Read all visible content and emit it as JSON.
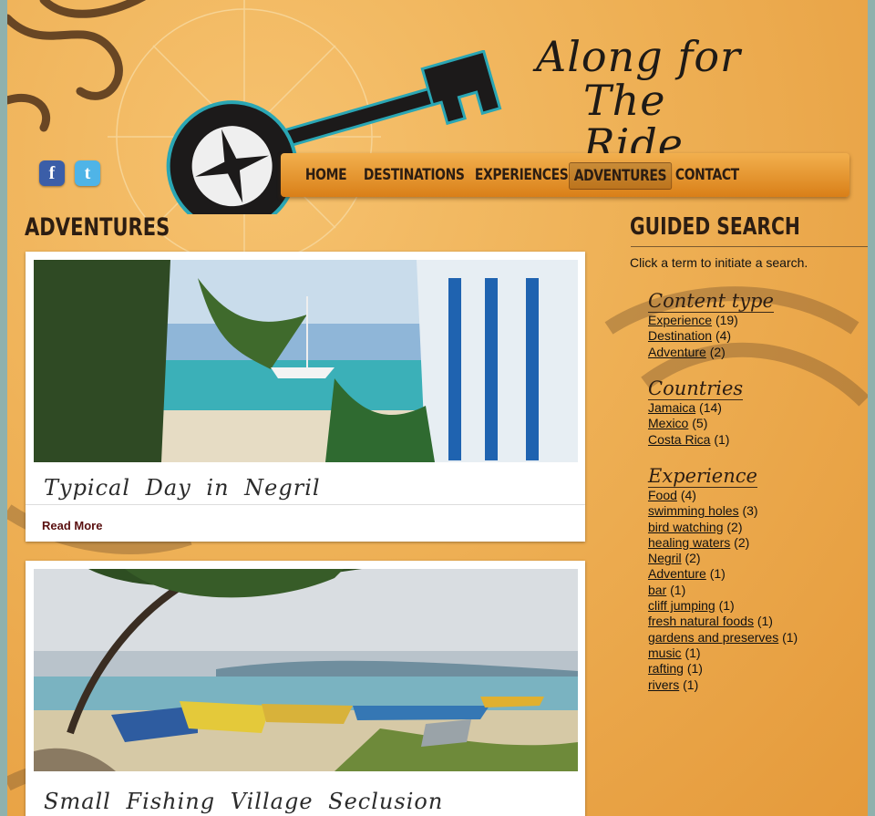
{
  "site": {
    "title_line1": "Along for",
    "title_line2": "The Ride",
    "social": [
      {
        "icon": "facebook-icon",
        "glyph": "f",
        "color": "#3b5ea8"
      },
      {
        "icon": "twitter-icon",
        "glyph": "t",
        "color": "#4fb4e7"
      }
    ]
  },
  "nav": {
    "items": [
      "HOME",
      "DESTINATIONS",
      "EXPERIENCES",
      "ADVENTURES",
      "CONTACT"
    ],
    "active": "ADVENTURES"
  },
  "main": {
    "heading": "ADVENTURES",
    "posts": [
      {
        "title": "Typical Day in Negril",
        "read_more": "Read More"
      },
      {
        "title": "Small Fishing Village Seclusion"
      }
    ]
  },
  "sidebar": {
    "heading": "GUIDED SEARCH",
    "help": "Click a term to initiate a search.",
    "facets": [
      {
        "title": "Content type",
        "items": [
          {
            "term": "Experience",
            "count": "(19)"
          },
          {
            "term": "Destination",
            "count": "(4)"
          },
          {
            "term": "Adventure",
            "count": "(2)"
          }
        ]
      },
      {
        "title": "Countries",
        "items": [
          {
            "term": "Jamaica",
            "count": "(14)"
          },
          {
            "term": "Mexico",
            "count": "(5)"
          },
          {
            "term": "Costa Rica",
            "count": "(1)"
          }
        ]
      },
      {
        "title": "Experience",
        "items": [
          {
            "term": "Food",
            "count": "(4)"
          },
          {
            "term": "swimming holes",
            "count": "(3)"
          },
          {
            "term": "bird watching",
            "count": "(2)"
          },
          {
            "term": "healing waters",
            "count": "(2)"
          },
          {
            "term": "Negril",
            "count": "(2)"
          },
          {
            "term": "Adventure",
            "count": "(1)"
          },
          {
            "term": "bar",
            "count": "(1)"
          },
          {
            "term": "cliff jumping",
            "count": "(1)"
          },
          {
            "term": "fresh natural foods",
            "count": "(1)"
          },
          {
            "term": "gardens and preserves",
            "count": "(1)"
          },
          {
            "term": "music",
            "count": "(1)"
          },
          {
            "term": "rafting",
            "count": "(1)"
          },
          {
            "term": "rivers",
            "count": "(1)"
          }
        ]
      }
    ]
  },
  "colors": {
    "parchment": "#eeb055",
    "nav_bar": "#e0891f",
    "dark_ink": "#2c1d12",
    "teal_accent": "#2aa6b4",
    "read_more": "#5a1010"
  }
}
